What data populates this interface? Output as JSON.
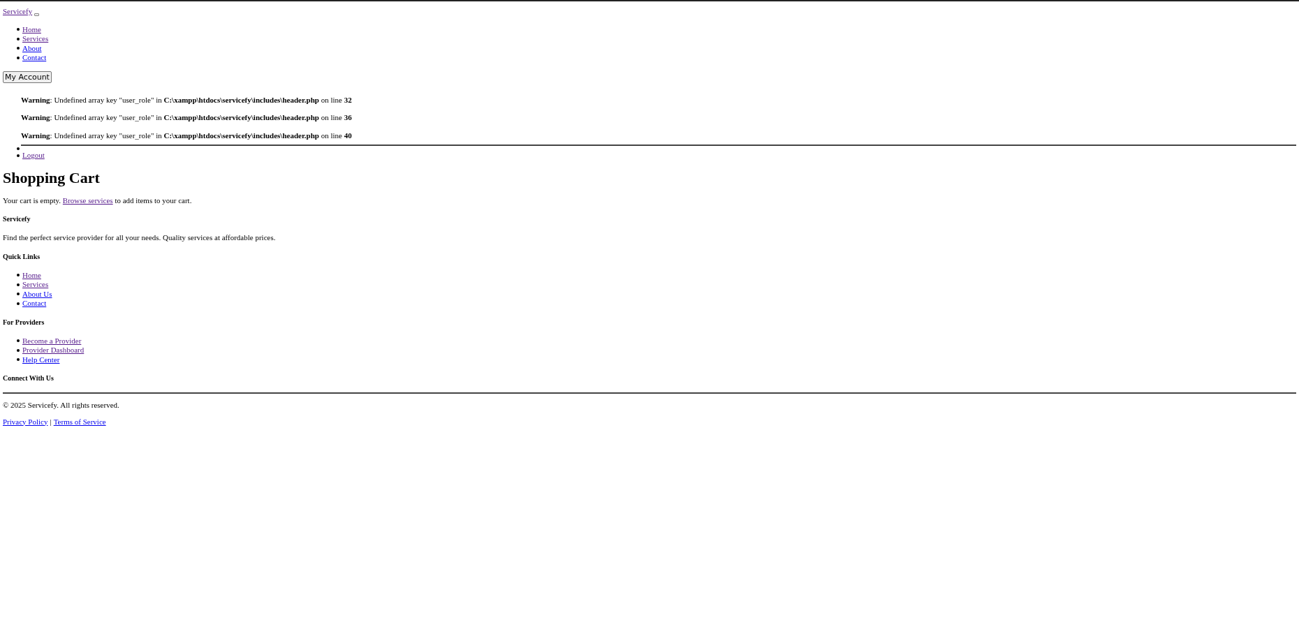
{
  "brand": {
    "text": "Servicefy",
    "visited": true
  },
  "nav": [
    {
      "label": "Home",
      "visited": true
    },
    {
      "label": "Services",
      "visited": true
    },
    {
      "label": "About",
      "visited": false
    },
    {
      "label": "Contact",
      "visited": false
    }
  ],
  "account_button": "My Account",
  "warnings": [
    "**Warning**: Undefined array key \"user_role\" in **C:\\xampp\\htdocs\\servicefy\\includes\\header.php** on line **32**",
    "**Warning**: Undefined array key \"user_role\" in **C:\\xampp\\htdocs\\servicefy\\includes\\header.php** on line **36**",
    "**Warning**: Undefined array key \"user_role\" in **C:\\xampp\\htdocs\\servicefy\\includes\\header.php** on line **40**"
  ],
  "account_menu": [
    {
      "label": "Logout",
      "visited": true
    }
  ],
  "page_title": "Shopping Cart",
  "empty_message": {
    "before": "Your cart is empty.",
    "link": {
      "label": "Browse services",
      "visited": true
    },
    "after": "to add items to your cart."
  },
  "footer": {
    "about": {
      "heading": "Servicefy",
      "text": "Find the perfect service provider for all your needs. Quality services at affordable prices."
    },
    "sections": [
      {
        "heading": "Quick Links",
        "links": [
          {
            "label": "Home",
            "visited": true
          },
          {
            "label": "Services",
            "visited": true
          },
          {
            "label": "About Us",
            "visited": false
          },
          {
            "label": "Contact",
            "visited": false
          }
        ]
      },
      {
        "heading": "For Providers",
        "links": [
          {
            "label": "Become a Provider",
            "visited": true
          },
          {
            "label": "Provider Dashboard",
            "visited": true
          },
          {
            "label": "Help Center",
            "visited": false
          }
        ]
      }
    ],
    "connect_heading": "Connect With Us",
    "copyright": "© 2025 Servicefy. All rights reserved.",
    "legal_links": [
      {
        "label": "Privacy Policy",
        "visited": false
      },
      {
        "label": "Terms of Service",
        "visited": false
      }
    ],
    "separator": "|"
  }
}
